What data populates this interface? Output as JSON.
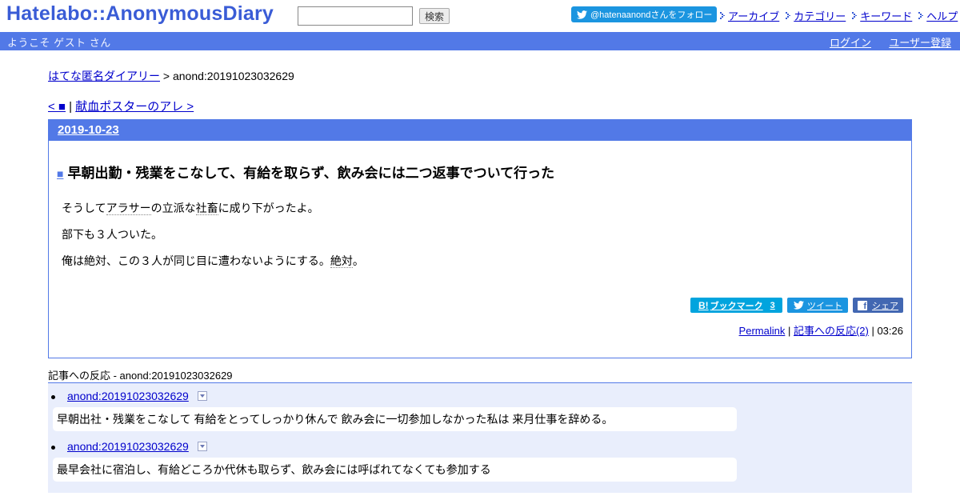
{
  "header": {
    "logo_text": "Hatelabo::AnonymousDiary",
    "search": {
      "value": "",
      "button_label": "検索"
    },
    "twitter_follow_label": "@hatenaanondさんをフォロー",
    "nav": [
      {
        "label": "アーカイブ"
      },
      {
        "label": "カテゴリー"
      },
      {
        "label": "キーワード"
      },
      {
        "label": "ヘルプ"
      }
    ]
  },
  "welcome_bar": {
    "greeting": "ようこそ ゲスト さん",
    "login_label": "ログイン",
    "register_label": "ユーザー登録"
  },
  "breadcrumb": {
    "home_label": "はてな匿名ダイアリー",
    "separator": " > ",
    "current": "anond:20191023032629"
  },
  "pager": {
    "prev_label": "< ■",
    "separator": " | ",
    "next_label": "献血ポスターのアレ >"
  },
  "day": {
    "date": "2019-10-23",
    "entry": {
      "title_marker": "■",
      "title": "早朝出勤・残業をこなして、有給を取らず、飲み会には二つ返事でついて行った",
      "paragraph_1": {
        "before": "そうして",
        "keyword_1": "アラサー",
        "middle": "の立派な",
        "keyword_2": "社畜",
        "after": "に成り下がったよ。"
      },
      "paragraph_2": "部下も３人ついた。",
      "paragraph_3": {
        "before": "俺は絶対、この３人が同じ目に遭わないようにする。",
        "keyword": "絶対",
        "after": "。"
      },
      "share": {
        "bookmark_logo": "B!",
        "bookmark_label": "ブックマーク",
        "bookmark_count": "3",
        "tweet_label": "ツイート",
        "facebook_logo": "f",
        "facebook_label": "シェア"
      },
      "footer": {
        "permalink_label": "Permalink",
        "separator": " | ",
        "reactions_label": "記事への反応(2)",
        "separator_2": " | ",
        "time": "03:26"
      }
    }
  },
  "reactions": {
    "heading": "記事への反応 - anond:20191023032629",
    "items": [
      {
        "link": "anond:20191023032629",
        "body": "早朝出社・残業をこなして 有給をとってしっかり休んで 飲み会に一切参加しなかった私は 来月仕事を辞める。"
      },
      {
        "link": "anond:20191023032629",
        "body": "最早会社に宿泊し、有給どころか代休も取らず、飲み会には呼ばれてなくても参加する"
      }
    ]
  },
  "colors": {
    "brand_blue": "#5279e7",
    "logo_blue": "#3a5cd6",
    "twitter_blue": "#1b95e0",
    "hatena_bookmark": "#00a4de",
    "facebook_blue": "#4267b2",
    "reactions_bg": "#e9eefc",
    "link": "#0000cc"
  },
  "icons": {
    "twitter": "twitter-bird-icon",
    "nav_arrow": "dotted-arrow-icon",
    "menu": "dropdown-triangle-icon",
    "facebook": "facebook-f-icon"
  }
}
